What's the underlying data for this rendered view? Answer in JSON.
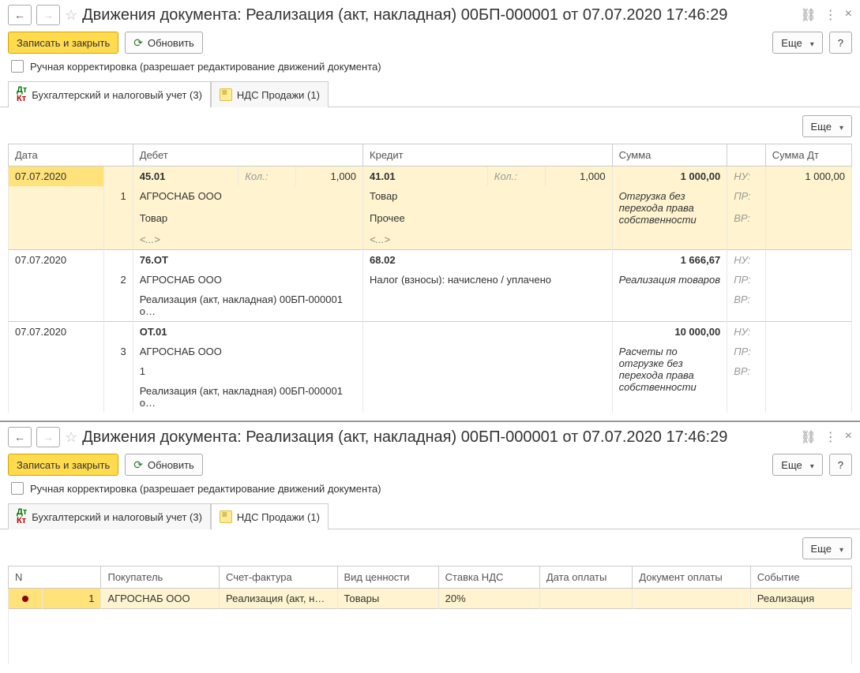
{
  "header": {
    "title": "Движения документа: Реализация (акт, накладная) 00БП-000001 от 07.07.2020 17:46:29"
  },
  "toolbar": {
    "save_close": "Записать и закрыть",
    "refresh": "Обновить",
    "more": "Еще",
    "help": "?"
  },
  "manual_edit": "Ручная корректировка (разрешает редактирование движений документа)",
  "tabs": {
    "accounting": "Бухгалтерский и налоговый учет (3)",
    "vat": "НДС Продажи (1)"
  },
  "cols1": {
    "date": "Дата",
    "debit": "Дебет",
    "credit": "Кредит",
    "sum": "Сумма",
    "sum_dt": "Сумма Дт"
  },
  "qty_label": "Кол.:",
  "nu": "НУ:",
  "pr": "ПР:",
  "vr": "ВР:",
  "placeholder": "<...>",
  "rows": [
    {
      "n": "1",
      "date": "07.07.2020",
      "d_acc": "45.01",
      "d_qty": "1,000",
      "d_l1": "АГРОСНАБ ООО",
      "d_l2": "Товар",
      "d_l3": "<...>",
      "c_acc": "41.01",
      "c_qty": "1,000",
      "c_l1": "Товар",
      "c_l2": "Прочее",
      "c_l3": "<...>",
      "sum": "1 000,00",
      "sum_dt": "1 000,00",
      "desc": "Отгрузка без перехода права собственности"
    },
    {
      "n": "2",
      "date": "07.07.2020",
      "d_acc": "76.ОТ",
      "d_l1": "АГРОСНАБ ООО",
      "d_l2": "Реализация (акт, накладная) 00БП-000001 о…",
      "c_acc": "68.02",
      "c_l1": "Налог (взносы): начислено / уплачено",
      "sum": "1 666,67",
      "desc": "Реализация товаров"
    },
    {
      "n": "3",
      "date": "07.07.2020",
      "d_acc": "ОТ.01",
      "d_l1": "АГРОСНАБ ООО",
      "d_l2": "1",
      "d_l3": "Реализация (акт, накладная) 00БП-000001 о…",
      "sum": "10 000,00",
      "desc": "Расчеты по отгрузке без перехода права собственности"
    }
  ],
  "cols2": {
    "n": "N",
    "buyer": "Покупатель",
    "invoice": "Счет-фактура",
    "type": "Вид ценности",
    "rate": "Ставка НДС",
    "pay_date": "Дата оплаты",
    "pay_doc": "Документ оплаты",
    "event": "Событие"
  },
  "vat_row": {
    "n": "1",
    "buyer": "АГРОСНАБ ООО",
    "invoice": "Реализация (акт, н…",
    "type": "Товары",
    "rate": "20%",
    "event": "Реализация"
  }
}
